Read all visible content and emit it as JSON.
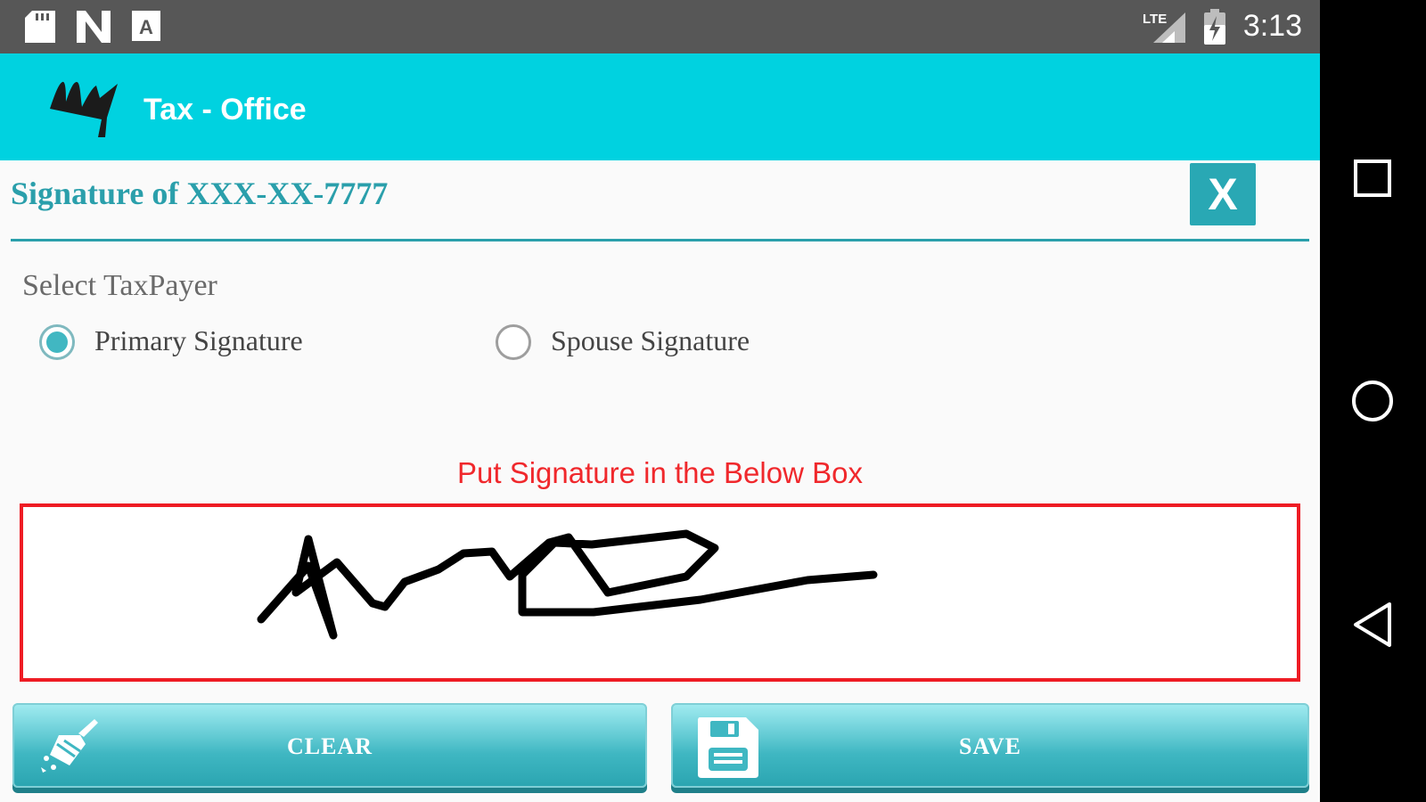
{
  "status_bar": {
    "time": "3:13",
    "left_icons": [
      "sd-card-icon",
      "n-notification-icon",
      "a-notification-icon"
    ],
    "right_icons": [
      "lte-signal-icon",
      "battery-icon"
    ]
  },
  "header": {
    "logo_text": "My",
    "title": "Tax - Office",
    "background": "#00d2e0"
  },
  "dialog": {
    "title": "Signature of XXX-XX-7777",
    "close_label": "X",
    "select_label": "Select TaxPayer",
    "options": [
      {
        "label": "Primary Signature",
        "checked": true
      },
      {
        "label": "Spouse Signature",
        "checked": false
      }
    ],
    "instruction": "Put Signature in the Below Box",
    "accent_color": "#2a9fab",
    "error_color": "#ee1c24"
  },
  "buttons": {
    "clear_label": "CLEAR",
    "save_label": "SAVE",
    "clear_icon": "broom-icon",
    "save_icon": "floppy-disk-icon"
  },
  "nav_bar": {
    "icons": [
      "recents-square-icon",
      "home-circle-icon",
      "back-triangle-icon"
    ]
  }
}
